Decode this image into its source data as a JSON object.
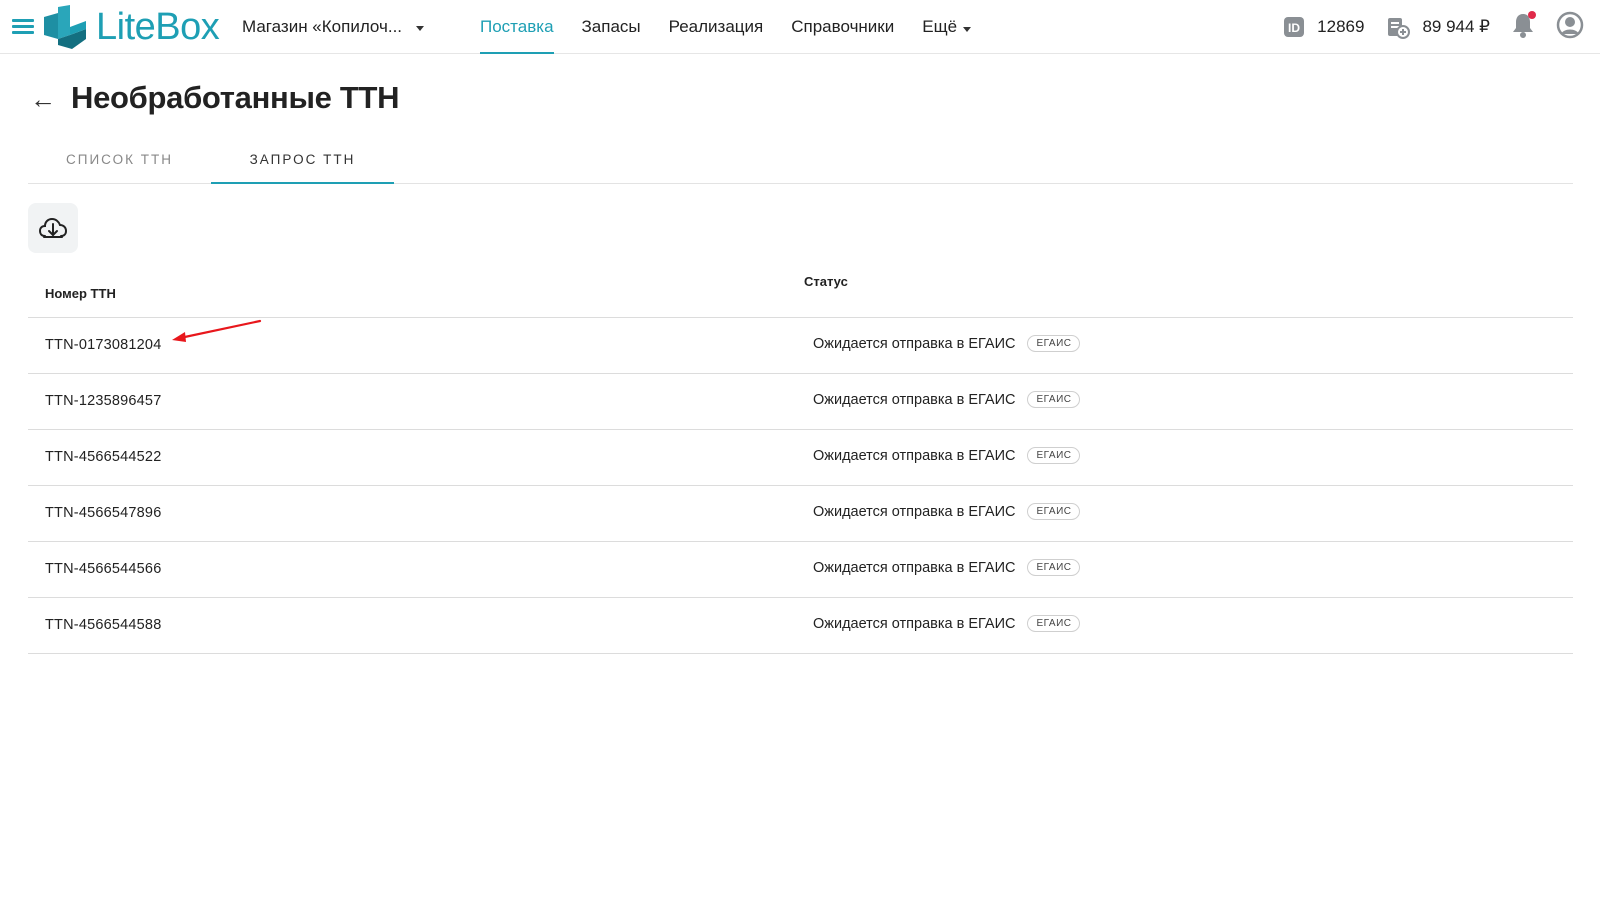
{
  "app": {
    "name": "LiteBox",
    "brand_color": "#1e9fb4"
  },
  "header": {
    "store_label": "Магазин «Копилоч...",
    "nav": [
      {
        "label": "Поставка",
        "active": true
      },
      {
        "label": "Запасы",
        "active": false
      },
      {
        "label": "Реализация",
        "active": false
      },
      {
        "label": "Справочники",
        "active": false
      },
      {
        "label": "Ещё",
        "active": false
      }
    ],
    "account_id": "12869",
    "balance": "89 944 ₽"
  },
  "page": {
    "title": "Необработанные ТТН",
    "tabs": [
      {
        "label": "СПИСОК ТТН",
        "active": false
      },
      {
        "label": "ЗАПРОС ТТН",
        "active": true
      }
    ]
  },
  "table": {
    "columns": {
      "number": "Номер ТТН",
      "status": "Статус"
    },
    "rows": [
      {
        "number": "TTN-0173081204",
        "status": "Ожидается отправка в ЕГАИС",
        "badge": "ЕГАИС"
      },
      {
        "number": "TTN-1235896457",
        "status": "Ожидается отправка в ЕГАИС",
        "badge": "ЕГАИС"
      },
      {
        "number": "TTN-4566544522",
        "status": "Ожидается отправка в ЕГАИС",
        "badge": "ЕГАИС"
      },
      {
        "number": "TTN-4566547896",
        "status": "Ожидается отправка в ЕГАИС",
        "badge": "ЕГАИС"
      },
      {
        "number": "TTN-4566544566",
        "status": "Ожидается отправка в ЕГАИС",
        "badge": "ЕГАИС"
      },
      {
        "number": "TTN-4566544588",
        "status": "Ожидается отправка в ЕГАИС",
        "badge": "ЕГАИС"
      }
    ]
  },
  "icons": {
    "menu": "hamburger-icon",
    "logo": "litebox-logo-icon",
    "id": "id-card-icon",
    "balance": "wallet-icon",
    "notifications": "bell-icon",
    "profile": "user-avatar-icon",
    "back": "arrow-left-icon",
    "download": "cloud-download-icon"
  }
}
